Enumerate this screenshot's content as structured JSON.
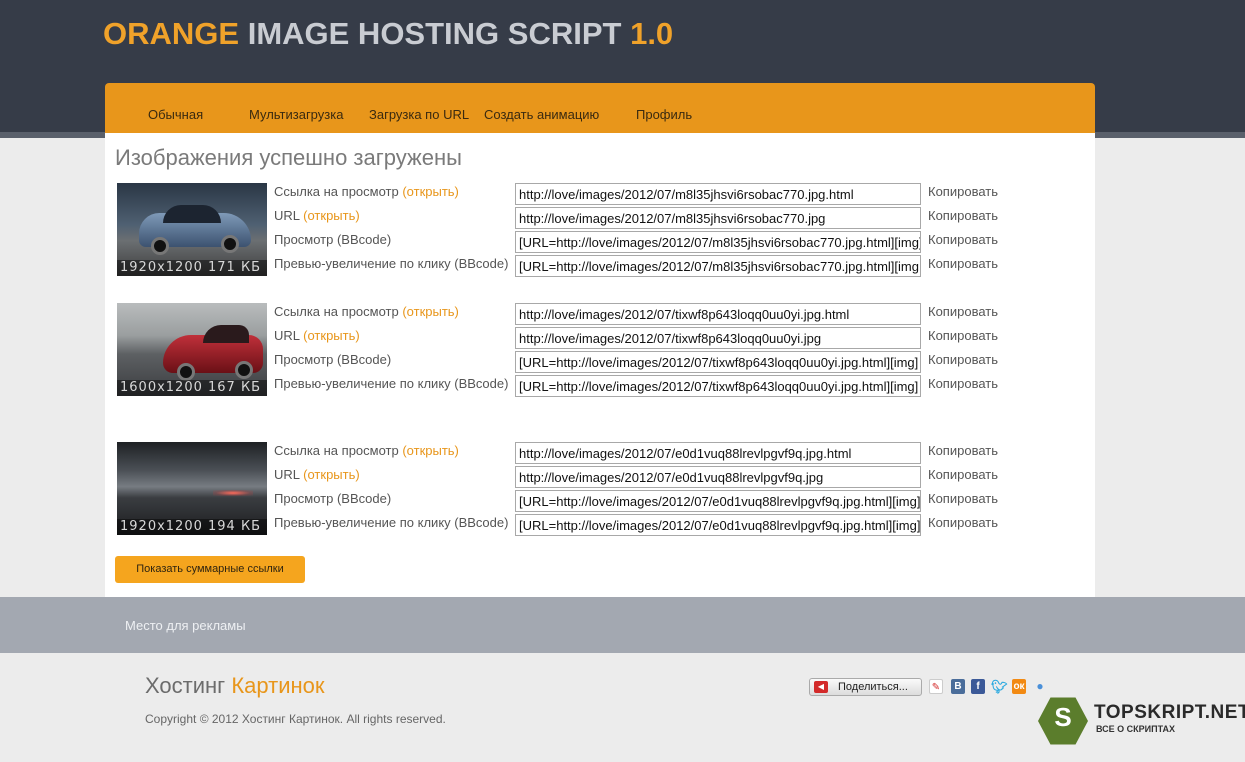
{
  "header": {
    "logo_part1": "ORANGE",
    "logo_part2": "IMAGE HOSTING SCRIPT",
    "logo_part3": "1.0"
  },
  "nav": {
    "items": [
      {
        "label": "Обычная"
      },
      {
        "label": "Мультизагрузка"
      },
      {
        "label": "Загрузка по URL"
      },
      {
        "label": "Создать анимацию"
      },
      {
        "label": "Профиль"
      }
    ]
  },
  "main": {
    "title": "Изображения успешно загружены",
    "open_label": "(открыть)",
    "copy_label": "Копировать",
    "row_labels": [
      "Ссылка на просмотр",
      "URL",
      "Просмотр (BBcode)",
      "Превью-увеличение по клику (BBcode)"
    ],
    "images": [
      {
        "caption": "1920x1200 171 КБ",
        "fields": [
          "http://love/images/2012/07/m8l35jhsvi6rsobac770.jpg.html",
          "http://love/images/2012/07/m8l35jhsvi6rsobac770.jpg",
          "[URL=http://love/images/2012/07/m8l35jhsvi6rsobac770.jpg.html][img]",
          "[URL=http://love/images/2012/07/m8l35jhsvi6rsobac770.jpg.html][img"
        ]
      },
      {
        "caption": "1600x1200 167 КБ",
        "fields": [
          "http://love/images/2012/07/tixwf8p643loqq0uu0yi.jpg.html",
          "http://love/images/2012/07/tixwf8p643loqq0uu0yi.jpg",
          "[URL=http://love/images/2012/07/tixwf8p643loqq0uu0yi.jpg.html][img]",
          "[URL=http://love/images/2012/07/tixwf8p643loqq0uu0yi.jpg.html][img]"
        ]
      },
      {
        "caption": "1920x1200 194 КБ",
        "fields": [
          "http://love/images/2012/07/e0d1vuq88lrevlpgvf9q.jpg.html",
          "http://love/images/2012/07/e0d1vuq88lrevlpgvf9q.jpg",
          "[URL=http://love/images/2012/07/e0d1vuq88lrevlpgvf9q.jpg.html][img]h",
          "[URL=http://love/images/2012/07/e0d1vuq88lrevlpgvf9q.jpg.html][img]h"
        ]
      }
    ],
    "summary_button": "Показать суммарные ссылки"
  },
  "ad": {
    "text": "Место для рекламы"
  },
  "footer": {
    "logo_part1": "Хостинг",
    "logo_part2": "Картинок",
    "copyright": "Copyright © 2012 Хостинг Картинок. All rights reserved.",
    "share_label": "Поделиться...",
    "social_icons": [
      {
        "icon": "vkontakte-icon",
        "glyph": "В",
        "color": "#4a6d9a"
      },
      {
        "icon": "facebook-icon",
        "glyph": "f",
        "color": "#3b5998"
      },
      {
        "icon": "twitter-icon",
        "glyph": "t",
        "color": "#2aa9e0"
      },
      {
        "icon": "odnoklassniki-icon",
        "glyph": "ок",
        "color": "#f28a13"
      }
    ]
  },
  "badge": {
    "letter": "S",
    "title": "TOPSKRIPT.NET",
    "subtitle": "ВСЕ О СКРИПТАХ"
  },
  "colors": {
    "accent": "#e8961b",
    "header_bg": "#363c48",
    "ad_bg": "#a3a8b1"
  }
}
